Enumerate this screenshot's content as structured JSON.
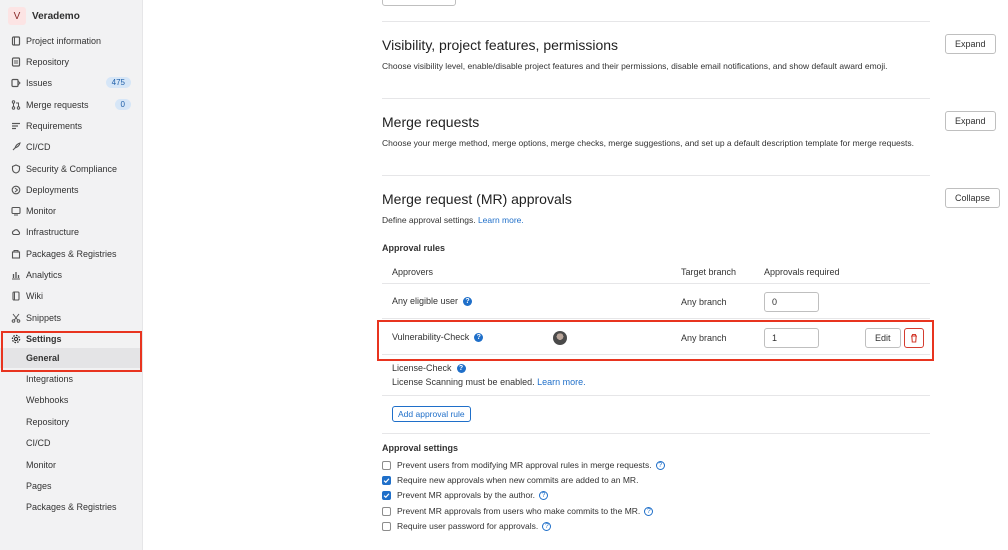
{
  "project": {
    "initial": "V",
    "name": "Verademo"
  },
  "sidebar": {
    "items": [
      {
        "label": "Project information",
        "icon": "info-icon"
      },
      {
        "label": "Repository",
        "icon": "repository-icon"
      },
      {
        "label": "Issues",
        "icon": "issues-icon",
        "badge": "475"
      },
      {
        "label": "Merge requests",
        "icon": "merge-request-icon",
        "badge": "0"
      },
      {
        "label": "Requirements",
        "icon": "requirements-icon"
      },
      {
        "label": "CI/CD",
        "icon": "rocket-icon"
      },
      {
        "label": "Security & Compliance",
        "icon": "shield-icon"
      },
      {
        "label": "Deployments",
        "icon": "deployments-icon"
      },
      {
        "label": "Monitor",
        "icon": "monitor-icon"
      },
      {
        "label": "Infrastructure",
        "icon": "cloud-icon"
      },
      {
        "label": "Packages & Registries",
        "icon": "package-icon"
      },
      {
        "label": "Analytics",
        "icon": "chart-icon"
      },
      {
        "label": "Wiki",
        "icon": "book-icon"
      },
      {
        "label": "Snippets",
        "icon": "scissors-icon"
      },
      {
        "label": "Settings",
        "icon": "gear-icon"
      }
    ],
    "settings_sub": [
      "General",
      "Integrations",
      "Webhooks",
      "Repository",
      "CI/CD",
      "Monitor",
      "Pages",
      "Packages & Registries"
    ]
  },
  "sections": {
    "visibility": {
      "title": "Visibility, project features, permissions",
      "desc": "Choose visibility level, enable/disable project features and their permissions, disable email notifications, and show default award emoji.",
      "button": "Expand"
    },
    "merge_requests": {
      "title": "Merge requests",
      "desc": "Choose your merge method, merge options, merge checks, merge suggestions, and set up a default description template for merge requests.",
      "button": "Expand"
    },
    "approvals": {
      "title": "Merge request (MR) approvals",
      "desc": "Define approval settings.",
      "learn_more": "Learn more.",
      "button": "Collapse"
    }
  },
  "approval_rules": {
    "heading": "Approval rules",
    "columns": {
      "approvers": "Approvers",
      "target_branch": "Target branch",
      "approvals_required": "Approvals required"
    },
    "rows": [
      {
        "name": "Any eligible user",
        "branch": "Any branch",
        "required": "0"
      },
      {
        "name": "Vulnerability-Check",
        "branch": "Any branch",
        "required": "1",
        "edit": "Edit"
      },
      {
        "name": "License-Check",
        "note": "License Scanning must be enabled.",
        "note_link": "Learn more."
      }
    ],
    "add_button": "Add approval rule"
  },
  "approval_settings": {
    "heading": "Approval settings",
    "options": [
      {
        "label": "Prevent users from modifying MR approval rules in merge requests.",
        "checked": false
      },
      {
        "label": "Require new approvals when new commits are added to an MR.",
        "checked": true
      },
      {
        "label": "Prevent MR approvals by the author.",
        "checked": true
      },
      {
        "label": "Prevent MR approvals from users who make commits to the MR.",
        "checked": false
      },
      {
        "label": "Require user password for approvals.",
        "checked": false
      }
    ]
  }
}
